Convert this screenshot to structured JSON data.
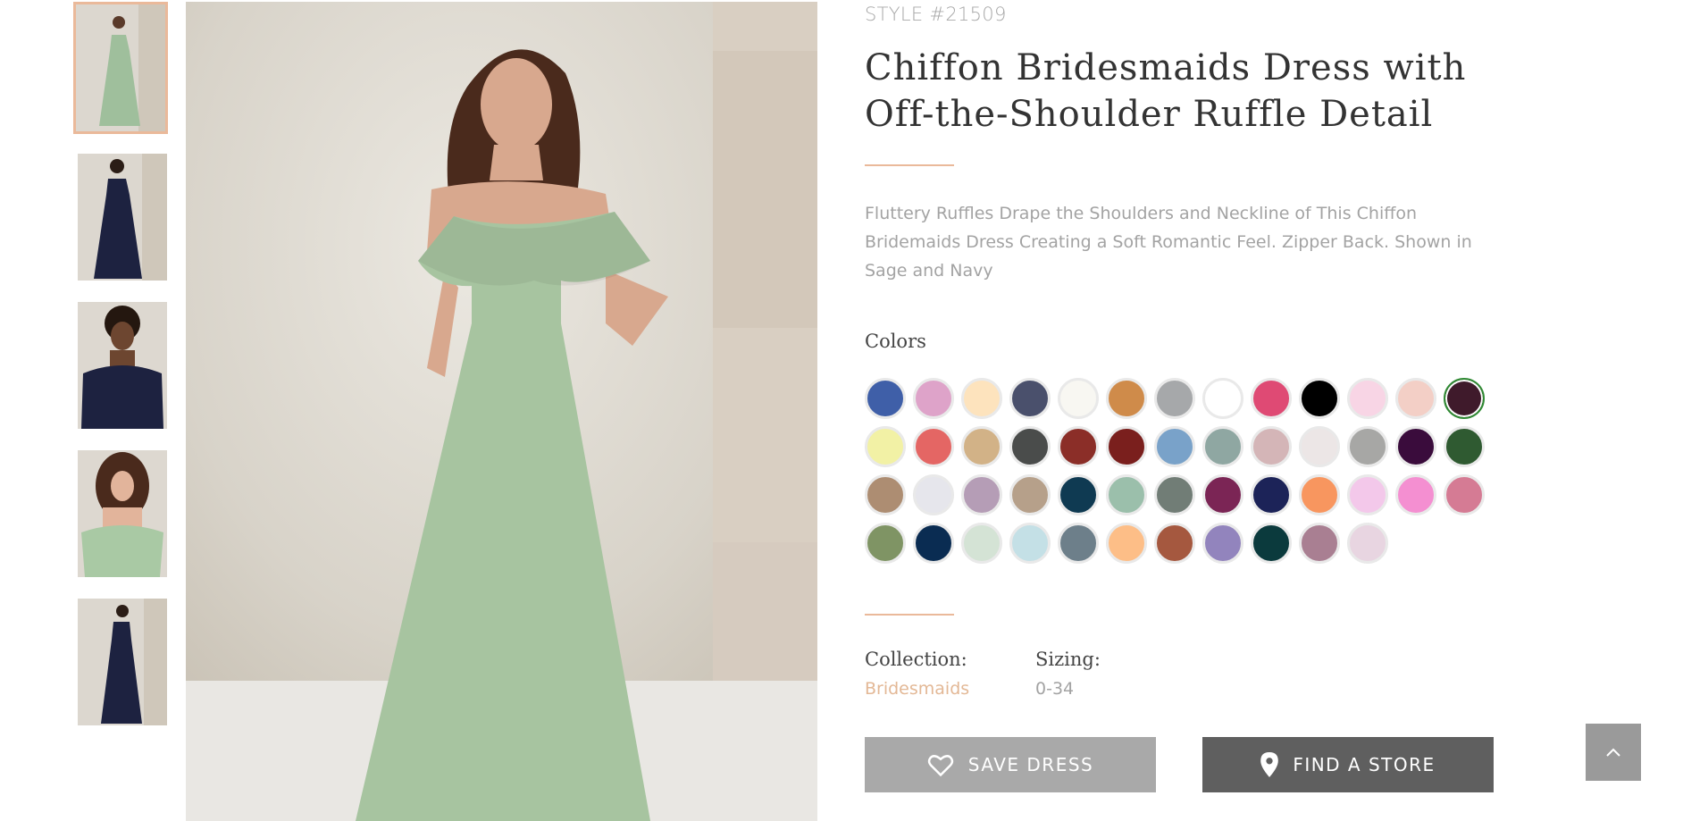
{
  "product": {
    "style_number": "STYLE #21509",
    "title": "Chiffon Bridesmaids Dress with Off-the-Shoulder Ruffle Detail",
    "description": "Fluttery Ruffles Drape the Shoulders and Neckline of This Chiffon Bridemaids Dress Creating a Soft Romantic Feel. Zipper Back. Shown in Sage and Navy"
  },
  "gallery": {
    "thumbnails": [
      {
        "dress_color": "#9fbf9c",
        "active": true
      },
      {
        "dress_color": "#1d2240",
        "active": false
      },
      {
        "dress_color": "#1d2240",
        "active": false
      },
      {
        "dress_color": "#a9c9a4",
        "active": false
      },
      {
        "dress_color": "#1d2240",
        "active": false
      }
    ],
    "main_dress_color": "#a7c4a0",
    "accent_color": "#eab99a"
  },
  "colors": {
    "label": "Colors",
    "swatches": [
      "#3f5fa8",
      "#dea3c9",
      "#fde3bd",
      "#4a506c",
      "#f8f7f2",
      "#cf8b4a",
      "#a6a8aa",
      "#ffffff",
      "#df4a74",
      "#000000",
      "#f8d5e5",
      "#f3cfc6",
      "#3f1a2b",
      "#f2f1a5",
      "#e46664",
      "#d2b287",
      "#4a4c4b",
      "#8b2e28",
      "#7a1f1d",
      "#79a2c9",
      "#8fa7a2",
      "#d4b5b7",
      "#ece6e6",
      "#a7a7a5",
      "#3a0c3c",
      "#2f5a31",
      "#ad8d72",
      "#e6e6ec",
      "#b59db6",
      "#b6a08a",
      "#0f3a52",
      "#9bbfab",
      "#717d76",
      "#7b2555",
      "#1c2358",
      "#f8965f",
      "#f3c8ea",
      "#f48fd1",
      "#d57b94",
      "#7f9464",
      "#0a2c52",
      "#d4e3d5",
      "#c4e0e6",
      "#6d7f8a",
      "#fdbe87",
      "#a5583f",
      "#9284bd",
      "#0b3a3d",
      "#a97f92",
      "#e8d5e1"
    ],
    "selected_index": 12
  },
  "meta": {
    "collection_label": "Collection:",
    "collection_value": "Bridesmaids",
    "collection_color": "#e3b896",
    "sizing_label": "Sizing:",
    "sizing_value": "0-34",
    "sizing_color": "#a3a3a3"
  },
  "actions": {
    "save_label": "SAVE DRESS",
    "save_icon": "heart-icon",
    "store_label": "FIND A STORE",
    "store_icon": "location-pin-icon",
    "top_icon": "chevron-up-icon"
  }
}
